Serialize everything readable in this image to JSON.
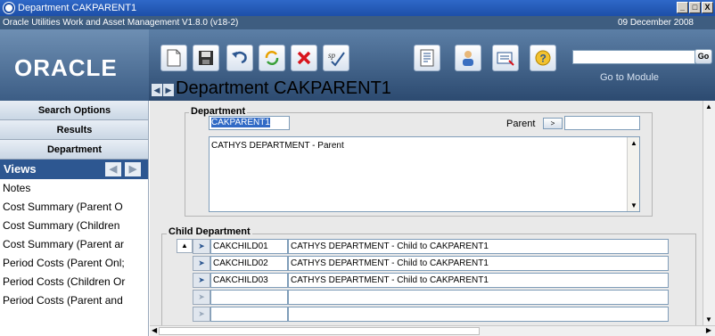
{
  "window": {
    "title": "Department CAKPARENT1",
    "buttons": [
      "_",
      "□",
      "X"
    ]
  },
  "infobar": {
    "app_version": "Oracle Utilities Work and Asset Management V1.8.0 (v18-2)",
    "date": "09 December  2008"
  },
  "header": {
    "logo": "ORACLE",
    "page_title": "Department CAKPARENT1",
    "go_button": "Go",
    "goto_label": "Go to Module",
    "goto_value": ""
  },
  "sidebar": {
    "tabs": [
      {
        "label": "Search Options"
      },
      {
        "label": "Results"
      },
      {
        "label": "Department"
      }
    ],
    "views_label": "Views",
    "views": [
      {
        "label": "Notes"
      },
      {
        "label": "Cost Summary (Parent O"
      },
      {
        "label": "Cost Summary (Children"
      },
      {
        "label": "Cost Summary (Parent ar"
      },
      {
        "label": "Period Costs (Parent Onl;"
      },
      {
        "label": "Period Costs (Children Or"
      },
      {
        "label": "Period Costs (Parent and"
      }
    ]
  },
  "department": {
    "section_label": "Department",
    "code": "CAKPARENT1",
    "parent_label": "Parent",
    "parent_value": "",
    "description": "CATHYS DEPARTMENT - Parent"
  },
  "child_department": {
    "section_label": "Child Department",
    "rows": [
      {
        "code": "CAKCHILD01",
        "description": "CATHYS DEPARTMENT - Child to CAKPARENT1"
      },
      {
        "code": "CAKCHILD02",
        "description": "CATHYS DEPARTMENT - Child to CAKPARENT1"
      },
      {
        "code": "CAKCHILD03",
        "description": "CATHYS DEPARTMENT - Child to CAKPARENT1"
      },
      {
        "code": "",
        "description": ""
      },
      {
        "code": "",
        "description": ""
      }
    ]
  },
  "colors": {
    "title_bar": "#2f68c8",
    "info_bar": "#3e5d80",
    "header": "#4a6c93",
    "views_bar": "#2d5791",
    "content_bg": "#e9e9e9"
  }
}
